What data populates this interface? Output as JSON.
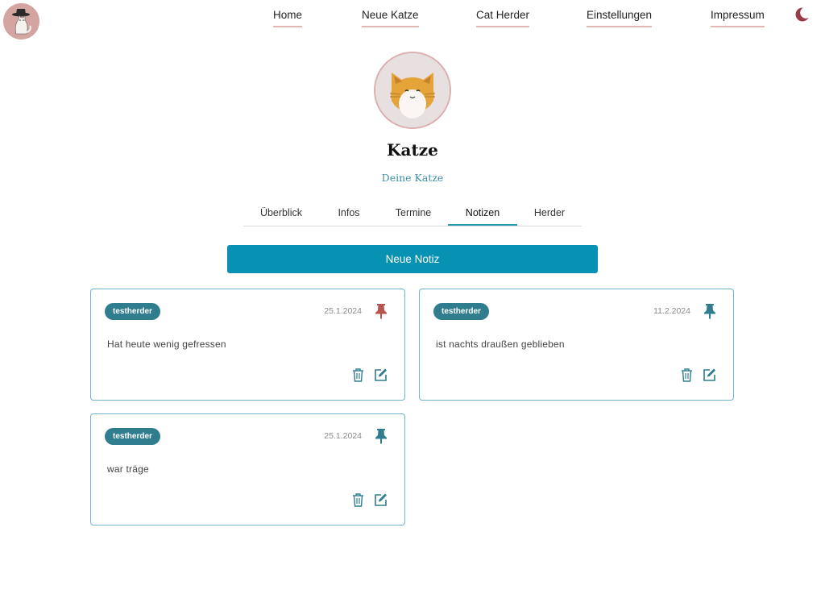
{
  "nav": {
    "items": [
      {
        "label": "Home"
      },
      {
        "label": "Neue Katze"
      },
      {
        "label": "Cat Herder"
      },
      {
        "label": "Einstellungen"
      },
      {
        "label": "Impressum"
      }
    ]
  },
  "profile": {
    "name": "Katze",
    "subtitle": "Deine Katze"
  },
  "tabs": [
    {
      "label": "Überblick"
    },
    {
      "label": "Infos"
    },
    {
      "label": "Termine"
    },
    {
      "label": "Notizen",
      "active": true
    },
    {
      "label": "Herder"
    }
  ],
  "new_note_label": "Neue Notiz",
  "notes": [
    {
      "author": "testherder",
      "date": "25.1.2024",
      "text": "Hat heute wenig gefressen",
      "pinned": true
    },
    {
      "author": "testherder",
      "date": "11.2.2024",
      "text": "ist nachts draußen geblieben",
      "pinned": false
    },
    {
      "author": "testherder",
      "date": "25.1.2024",
      "text": "war träge",
      "pinned": false
    }
  ],
  "colors": {
    "accent": "#0791b2",
    "badge": "#2f7d8e",
    "pin_active": "#b5554d",
    "pin_inactive": "#2f7d8e",
    "card_border": "#6fb3cc",
    "moon": "#9a3a46"
  },
  "icons": [
    "cat-herder-logo",
    "moon-icon",
    "cat-avatar",
    "pin-icon",
    "trash-icon",
    "edit-icon"
  ]
}
